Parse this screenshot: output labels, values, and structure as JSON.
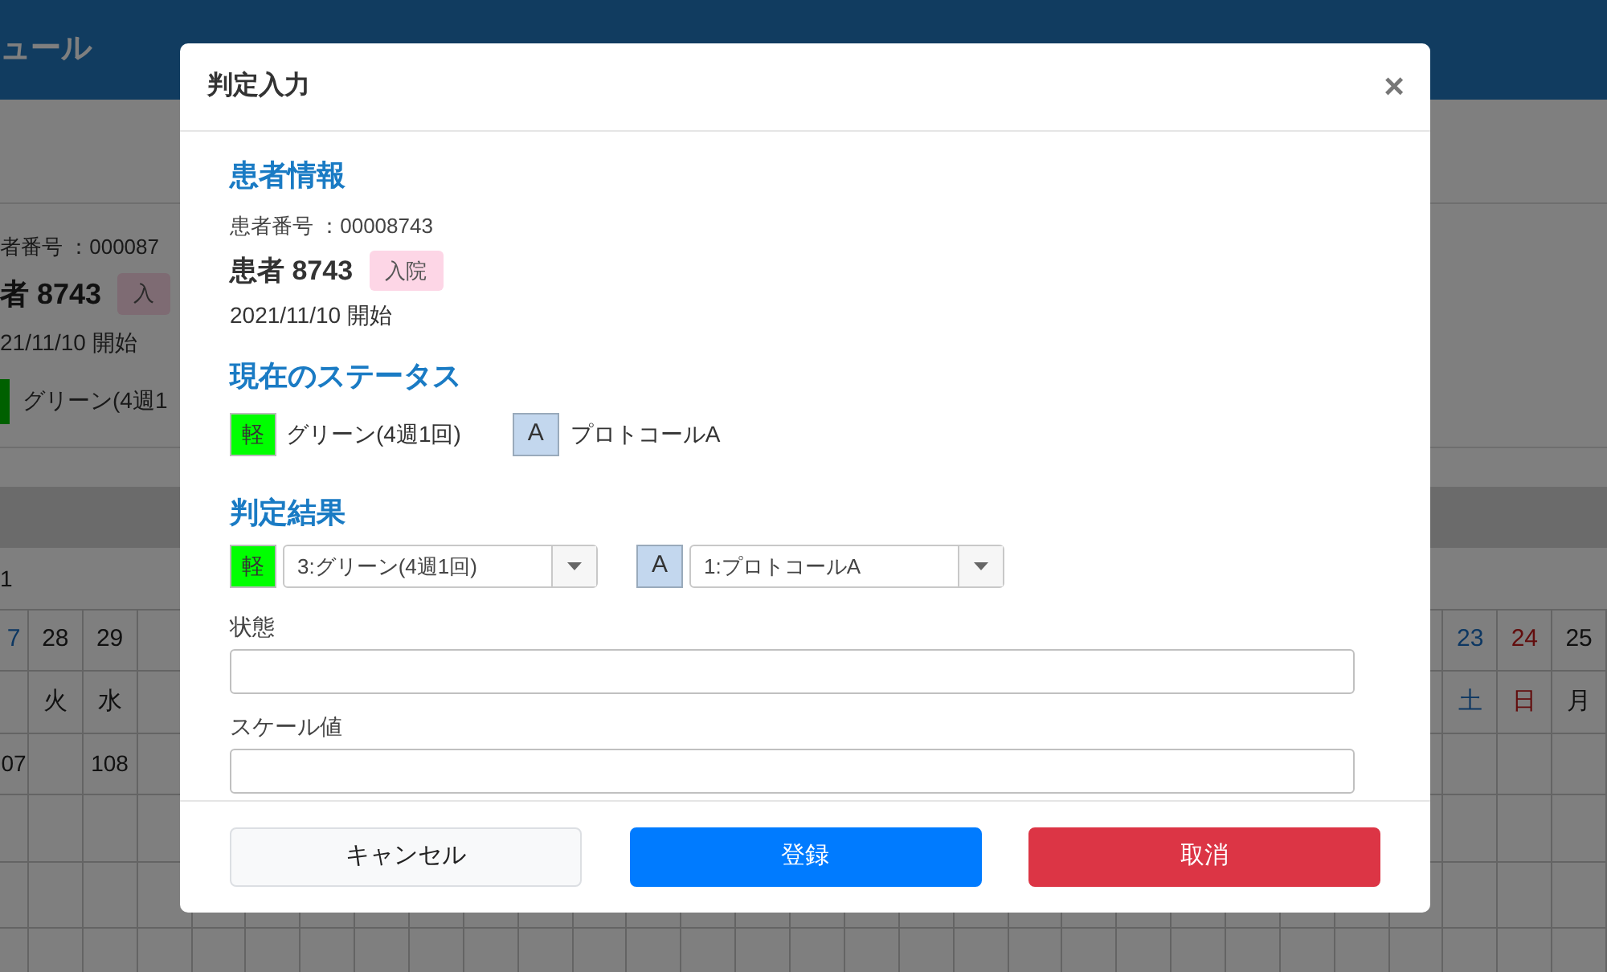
{
  "background": {
    "header_title": "ュール",
    "patient_id": "者番号 ：000087",
    "patient_name": "者 8743",
    "badge": "入",
    "start": "21/11/10 開始",
    "status": {
      "label": "グリーン(4週1"
    },
    "row_label": "1",
    "calendar": {
      "left": [
        {
          "date": "7",
          "kind": "highlight",
          "count": "07"
        },
        {
          "date": "28",
          "weekday": "火",
          "kind": "weekday"
        },
        {
          "date": "29",
          "weekday": "水",
          "kind": "weekday",
          "count": "108"
        }
      ],
      "right": [
        {
          "date": "23",
          "weekday": "土",
          "kind": "saturday"
        },
        {
          "date": "24",
          "weekday": "日",
          "kind": "sunday"
        },
        {
          "date": "25",
          "weekday": "月",
          "kind": "weekday"
        }
      ]
    }
  },
  "dialog": {
    "title": "判定入力",
    "close": "×",
    "patient": {
      "heading": "患者情報",
      "id_line": "患者番号 ：00008743",
      "name": "患者 8743",
      "badge": "入院",
      "start": "2021/11/10 開始"
    },
    "current_status": {
      "heading": "現在のステータス",
      "level": {
        "tag": "軽",
        "label": "グリーン(4週1回)",
        "color": "#00ff00"
      },
      "protocol": {
        "tag": "A",
        "label": "プロトコールA"
      }
    },
    "result": {
      "heading": "判定結果",
      "level": {
        "tag": "軽",
        "color": "#00ff00",
        "value": "3:グリーン(4週1回)"
      },
      "protocol": {
        "tag": "A",
        "value": "1:プロトコールA"
      }
    },
    "fields": [
      {
        "label": "状態"
      },
      {
        "label": "スケール値"
      }
    ],
    "buttons": [
      {
        "label": "キャンセル",
        "kind": "secondary"
      },
      {
        "label": "登録",
        "kind": "primary"
      },
      {
        "label": "取消",
        "kind": "danger"
      }
    ]
  }
}
